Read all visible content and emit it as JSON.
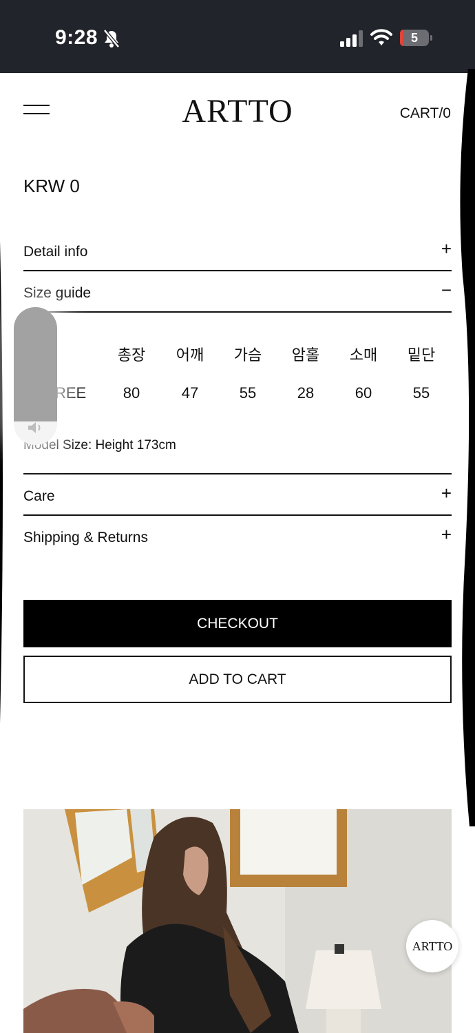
{
  "status_bar": {
    "time": "9:28",
    "battery": "5"
  },
  "header": {
    "logo": "ARTTO",
    "cart": "CART/0"
  },
  "product": {
    "price": "KRW 0"
  },
  "accordion": {
    "detail_info": {
      "label": "Detail info",
      "sign": "+"
    },
    "size_guide": {
      "label": "Size guide",
      "sign": "−"
    },
    "care": {
      "label": "Care",
      "sign": "+"
    },
    "shipping": {
      "label": "Shipping & Returns",
      "sign": "+"
    }
  },
  "size_guide": {
    "headers": [
      "총장",
      "어깨",
      "가슴",
      "암홀",
      "소매",
      "밑단"
    ],
    "row_label": "REE",
    "values": [
      "80",
      "47",
      "55",
      "28",
      "60",
      "55"
    ],
    "model_size": "Model Size: Height 173cm"
  },
  "buttons": {
    "checkout": "CHECKOUT",
    "add_to_cart": "ADD TO CART"
  },
  "chat": {
    "label": "ARTTO"
  },
  "volume": {
    "level": 0.83
  }
}
